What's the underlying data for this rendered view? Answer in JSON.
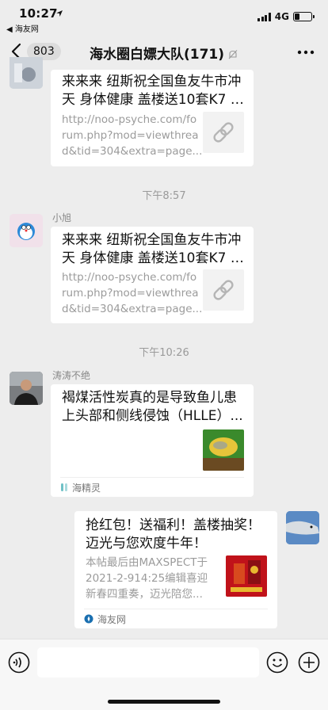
{
  "status_bar": {
    "time": "10:27",
    "back_app": "◀ 海友网",
    "network": "4G",
    "battery_level": 0.3
  },
  "nav": {
    "unread_count": "803",
    "title": "海水圈白嫖大队(171)"
  },
  "messages": [
    {
      "title_line1": "来来来 纽斯祝全国鱼友牛市冲",
      "title_line2": "天 身体健康 盖楼送10套K7 -...",
      "desc_line1": "http://noo-psyche.com/fo",
      "desc_line2": "rum.php?mod=viewthrea",
      "desc_line3": "d&tid=304&extra=page..."
    },
    {
      "timestamp": "下午8:57",
      "sender": "小旭",
      "title_line1": "来来来 纽斯祝全国鱼友牛市冲",
      "title_line2": "天 身体健康 盖楼送10套K7 -...",
      "desc_line1": "http://noo-psyche.com/fo",
      "desc_line2": "rum.php?mod=viewthrea",
      "desc_line3": "d&tid=304&extra=page..."
    },
    {
      "timestamp": "下午10:26",
      "sender": "涛涛不绝",
      "title_line1": "褐煤活性炭真的是导致鱼儿患",
      "title_line2": "上头部和侧线侵蚀（HLLE）...",
      "source": "海精灵"
    },
    {
      "title_line1": "抢红包！送福利！盖楼抽奖！",
      "title_line2": "迈光与您欢度牛年！",
      "desc_line1": "本帖最后由MAXSPECT于",
      "desc_line2": "2021-2-914:25编辑喜迎",
      "desc_line3": "新春四重奏，迈光陪您...",
      "source": "海友网"
    }
  ]
}
